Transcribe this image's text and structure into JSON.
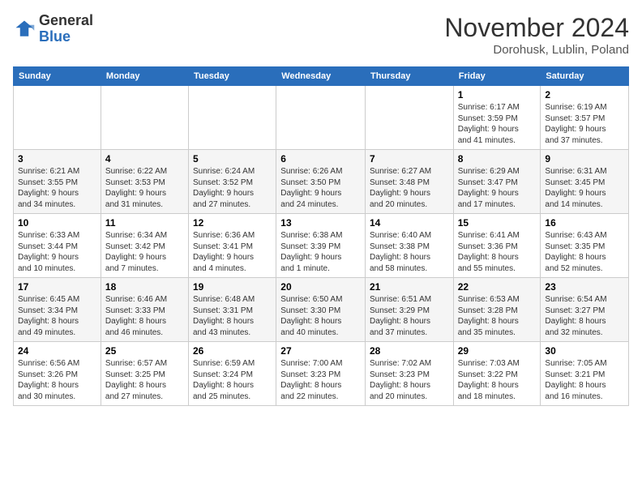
{
  "header": {
    "logo_general": "General",
    "logo_blue": "Blue",
    "title": "November 2024",
    "location": "Dorohusk, Lublin, Poland"
  },
  "columns": [
    "Sunday",
    "Monday",
    "Tuesday",
    "Wednesday",
    "Thursday",
    "Friday",
    "Saturday"
  ],
  "weeks": [
    [
      {
        "day": "",
        "info": ""
      },
      {
        "day": "",
        "info": ""
      },
      {
        "day": "",
        "info": ""
      },
      {
        "day": "",
        "info": ""
      },
      {
        "day": "",
        "info": ""
      },
      {
        "day": "1",
        "info": "Sunrise: 6:17 AM\nSunset: 3:59 PM\nDaylight: 9 hours\nand 41 minutes."
      },
      {
        "day": "2",
        "info": "Sunrise: 6:19 AM\nSunset: 3:57 PM\nDaylight: 9 hours\nand 37 minutes."
      }
    ],
    [
      {
        "day": "3",
        "info": "Sunrise: 6:21 AM\nSunset: 3:55 PM\nDaylight: 9 hours\nand 34 minutes."
      },
      {
        "day": "4",
        "info": "Sunrise: 6:22 AM\nSunset: 3:53 PM\nDaylight: 9 hours\nand 31 minutes."
      },
      {
        "day": "5",
        "info": "Sunrise: 6:24 AM\nSunset: 3:52 PM\nDaylight: 9 hours\nand 27 minutes."
      },
      {
        "day": "6",
        "info": "Sunrise: 6:26 AM\nSunset: 3:50 PM\nDaylight: 9 hours\nand 24 minutes."
      },
      {
        "day": "7",
        "info": "Sunrise: 6:27 AM\nSunset: 3:48 PM\nDaylight: 9 hours\nand 20 minutes."
      },
      {
        "day": "8",
        "info": "Sunrise: 6:29 AM\nSunset: 3:47 PM\nDaylight: 9 hours\nand 17 minutes."
      },
      {
        "day": "9",
        "info": "Sunrise: 6:31 AM\nSunset: 3:45 PM\nDaylight: 9 hours\nand 14 minutes."
      }
    ],
    [
      {
        "day": "10",
        "info": "Sunrise: 6:33 AM\nSunset: 3:44 PM\nDaylight: 9 hours\nand 10 minutes."
      },
      {
        "day": "11",
        "info": "Sunrise: 6:34 AM\nSunset: 3:42 PM\nDaylight: 9 hours\nand 7 minutes."
      },
      {
        "day": "12",
        "info": "Sunrise: 6:36 AM\nSunset: 3:41 PM\nDaylight: 9 hours\nand 4 minutes."
      },
      {
        "day": "13",
        "info": "Sunrise: 6:38 AM\nSunset: 3:39 PM\nDaylight: 9 hours\nand 1 minute."
      },
      {
        "day": "14",
        "info": "Sunrise: 6:40 AM\nSunset: 3:38 PM\nDaylight: 8 hours\nand 58 minutes."
      },
      {
        "day": "15",
        "info": "Sunrise: 6:41 AM\nSunset: 3:36 PM\nDaylight: 8 hours\nand 55 minutes."
      },
      {
        "day": "16",
        "info": "Sunrise: 6:43 AM\nSunset: 3:35 PM\nDaylight: 8 hours\nand 52 minutes."
      }
    ],
    [
      {
        "day": "17",
        "info": "Sunrise: 6:45 AM\nSunset: 3:34 PM\nDaylight: 8 hours\nand 49 minutes."
      },
      {
        "day": "18",
        "info": "Sunrise: 6:46 AM\nSunset: 3:33 PM\nDaylight: 8 hours\nand 46 minutes."
      },
      {
        "day": "19",
        "info": "Sunrise: 6:48 AM\nSunset: 3:31 PM\nDaylight: 8 hours\nand 43 minutes."
      },
      {
        "day": "20",
        "info": "Sunrise: 6:50 AM\nSunset: 3:30 PM\nDaylight: 8 hours\nand 40 minutes."
      },
      {
        "day": "21",
        "info": "Sunrise: 6:51 AM\nSunset: 3:29 PM\nDaylight: 8 hours\nand 37 minutes."
      },
      {
        "day": "22",
        "info": "Sunrise: 6:53 AM\nSunset: 3:28 PM\nDaylight: 8 hours\nand 35 minutes."
      },
      {
        "day": "23",
        "info": "Sunrise: 6:54 AM\nSunset: 3:27 PM\nDaylight: 8 hours\nand 32 minutes."
      }
    ],
    [
      {
        "day": "24",
        "info": "Sunrise: 6:56 AM\nSunset: 3:26 PM\nDaylight: 8 hours\nand 30 minutes."
      },
      {
        "day": "25",
        "info": "Sunrise: 6:57 AM\nSunset: 3:25 PM\nDaylight: 8 hours\nand 27 minutes."
      },
      {
        "day": "26",
        "info": "Sunrise: 6:59 AM\nSunset: 3:24 PM\nDaylight: 8 hours\nand 25 minutes."
      },
      {
        "day": "27",
        "info": "Sunrise: 7:00 AM\nSunset: 3:23 PM\nDaylight: 8 hours\nand 22 minutes."
      },
      {
        "day": "28",
        "info": "Sunrise: 7:02 AM\nSunset: 3:23 PM\nDaylight: 8 hours\nand 20 minutes."
      },
      {
        "day": "29",
        "info": "Sunrise: 7:03 AM\nSunset: 3:22 PM\nDaylight: 8 hours\nand 18 minutes."
      },
      {
        "day": "30",
        "info": "Sunrise: 7:05 AM\nSunset: 3:21 PM\nDaylight: 8 hours\nand 16 minutes."
      }
    ]
  ]
}
